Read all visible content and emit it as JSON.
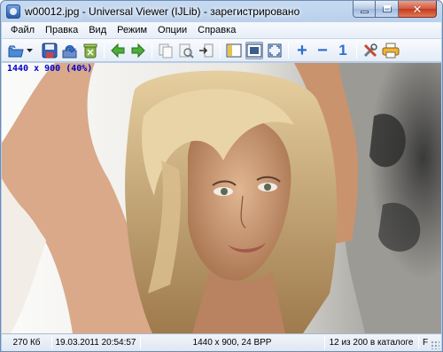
{
  "window": {
    "title": "w00012.jpg - Universal Viewer (IJLib) - зарегистрировано"
  },
  "menu": {
    "items": [
      "Файл",
      "Правка",
      "Вид",
      "Режим",
      "Опции",
      "Справка"
    ]
  },
  "toolbar": {
    "buttons": [
      "open-folder-icon",
      "save-icon",
      "reload-icon",
      "delete-icon",
      "previous-icon",
      "next-icon",
      "copy-icon",
      "find-icon",
      "goto-icon",
      "panel-icon",
      "fit-window-icon",
      "fullscreen-icon",
      "zoom-in-icon",
      "zoom-out-icon",
      "actual-size-icon",
      "tools-icon",
      "print-icon"
    ],
    "actual_size_glyph": "1",
    "zoom_in_glyph": "+",
    "zoom_out_glyph": "−"
  },
  "viewer": {
    "image_info": "1440 x 900 (40%)"
  },
  "status": {
    "size": "270 Кб",
    "date": "19.03.2011 20:54:57",
    "dimensions": "1440 x 900, 24 BPP",
    "position": "12 из 200 в каталоге",
    "flag": "F"
  },
  "colors": {
    "accent": "#2a5aa8",
    "info_text": "#0000cc"
  }
}
